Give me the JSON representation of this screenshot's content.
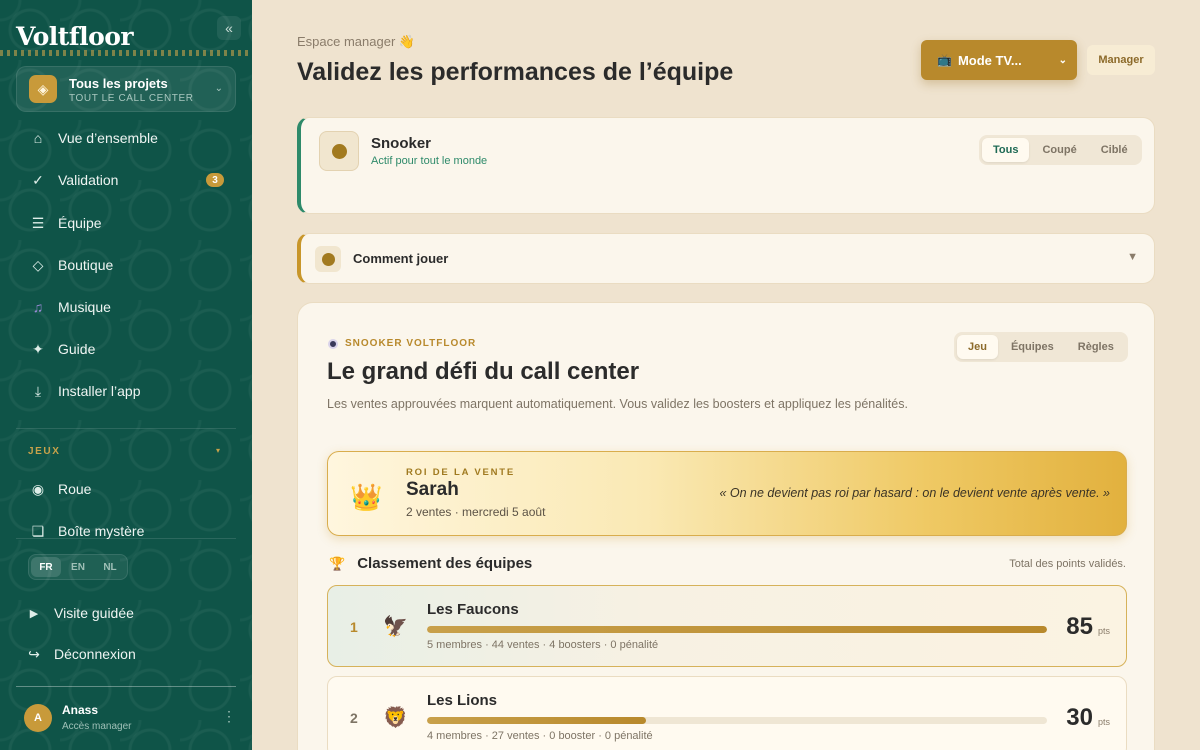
{
  "brand": "Voltfloor",
  "sidebar": {
    "collapse_icon": "«",
    "project": {
      "title": "Tous les projets",
      "subtitle": "TOUT LE CALL CENTER"
    },
    "nav": [
      {
        "label": "Vue d’ensemble",
        "icon": "home-icon",
        "glyph": "⌂"
      },
      {
        "label": "Validation",
        "icon": "check-icon",
        "glyph": "✓",
        "badge": "3"
      },
      {
        "label": "Équipe",
        "icon": "list-icon",
        "glyph": "☰"
      },
      {
        "label": "Boutique",
        "icon": "diamond-icon",
        "glyph": "◇"
      },
      {
        "label": "Musique",
        "icon": "music-icon",
        "glyph": "♫"
      },
      {
        "label": "Guide",
        "icon": "sparkle-icon",
        "glyph": "✦"
      },
      {
        "label": "Installer l’app",
        "icon": "download-icon",
        "glyph": "⤓"
      }
    ],
    "games_section": "JEUX",
    "games": [
      {
        "label": "Roue",
        "icon": "wheel-icon",
        "glyph": "◉"
      },
      {
        "label": "Boîte mystère",
        "icon": "box-icon",
        "glyph": "❏"
      }
    ],
    "languages": [
      "FR",
      "EN",
      "NL"
    ],
    "active_language": "FR",
    "footer_nav": [
      {
        "label": "Visite guidée",
        "icon": "play-icon",
        "glyph": "▶"
      },
      {
        "label": "Déconnexion",
        "icon": "logout-icon",
        "glyph": "↪"
      }
    ],
    "user": {
      "initial": "A",
      "name": "Anass",
      "role": "Accès manager"
    }
  },
  "header": {
    "eyebrow": "Espace manager 👋",
    "title": "Validez les performances de l’équipe",
    "tv_button": "Mode TV...",
    "tv_icon": "📺",
    "role": "Manager"
  },
  "game_card": {
    "title": "Snooker",
    "subtitle": "Actif pour tout le monde",
    "filters": [
      "Tous",
      "Coupé",
      "Ciblé"
    ],
    "active_filter": "Tous"
  },
  "howto": {
    "title": "Comment jouer"
  },
  "main": {
    "eyebrow": "SNOOKER VOLTFLOOR",
    "tabs": [
      "Jeu",
      "Équipes",
      "Règles"
    ],
    "active_tab": "Jeu",
    "title": "Le grand défi du call center",
    "description": "Les ventes approuvées marquent automatiquement. Vous validez les boosters et appliquez les pénalités.",
    "king": {
      "label": "ROI DE LA VENTE",
      "name": "Sarah",
      "meta": "2 ventes · mercredi 5 août",
      "quote": "« On ne devient pas roi par hasard : on le devient vente après vente. »"
    },
    "ranking_title": "Classement des équipes",
    "ranking_note": "Total des points validés.",
    "teams": [
      {
        "rank": "1",
        "icon": "🦅",
        "name": "Les Faucons",
        "stats": "5 membres · 44 ventes · 4 boosters · 0 pénalité",
        "points": "85",
        "unit": "pts",
        "progress": 1.0
      },
      {
        "rank": "2",
        "icon": "🦁",
        "name": "Les Lions",
        "stats": "4 membres · 27 ventes · 0 booster · 0 pénalité",
        "points": "30",
        "unit": "pts",
        "progress": 0.353
      }
    ]
  }
}
